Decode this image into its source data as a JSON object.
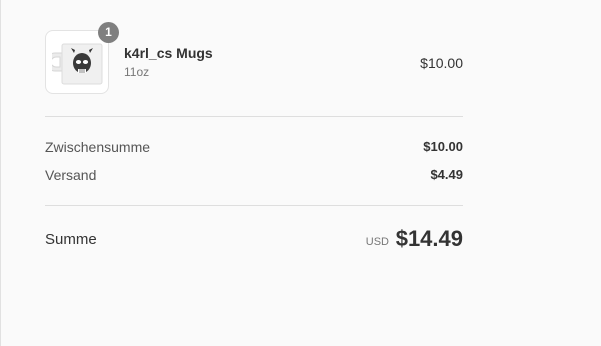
{
  "order_summary": {
    "item": {
      "quantity_badge": "1",
      "name": "k4rl_cs Mugs",
      "variant": "11oz",
      "price": "$10.00",
      "image_icon": "mug-with-skull-print"
    },
    "subtotal": {
      "label": "Zwischensumme",
      "value": "$10.00"
    },
    "shipping": {
      "label": "Versand",
      "value": "$4.49"
    },
    "total": {
      "label": "Summe",
      "currency": "USD",
      "value": "$14.49"
    }
  },
  "colors": {
    "background": "#fafafa",
    "badge": "#7f7f7f",
    "divider": "#dedede"
  }
}
